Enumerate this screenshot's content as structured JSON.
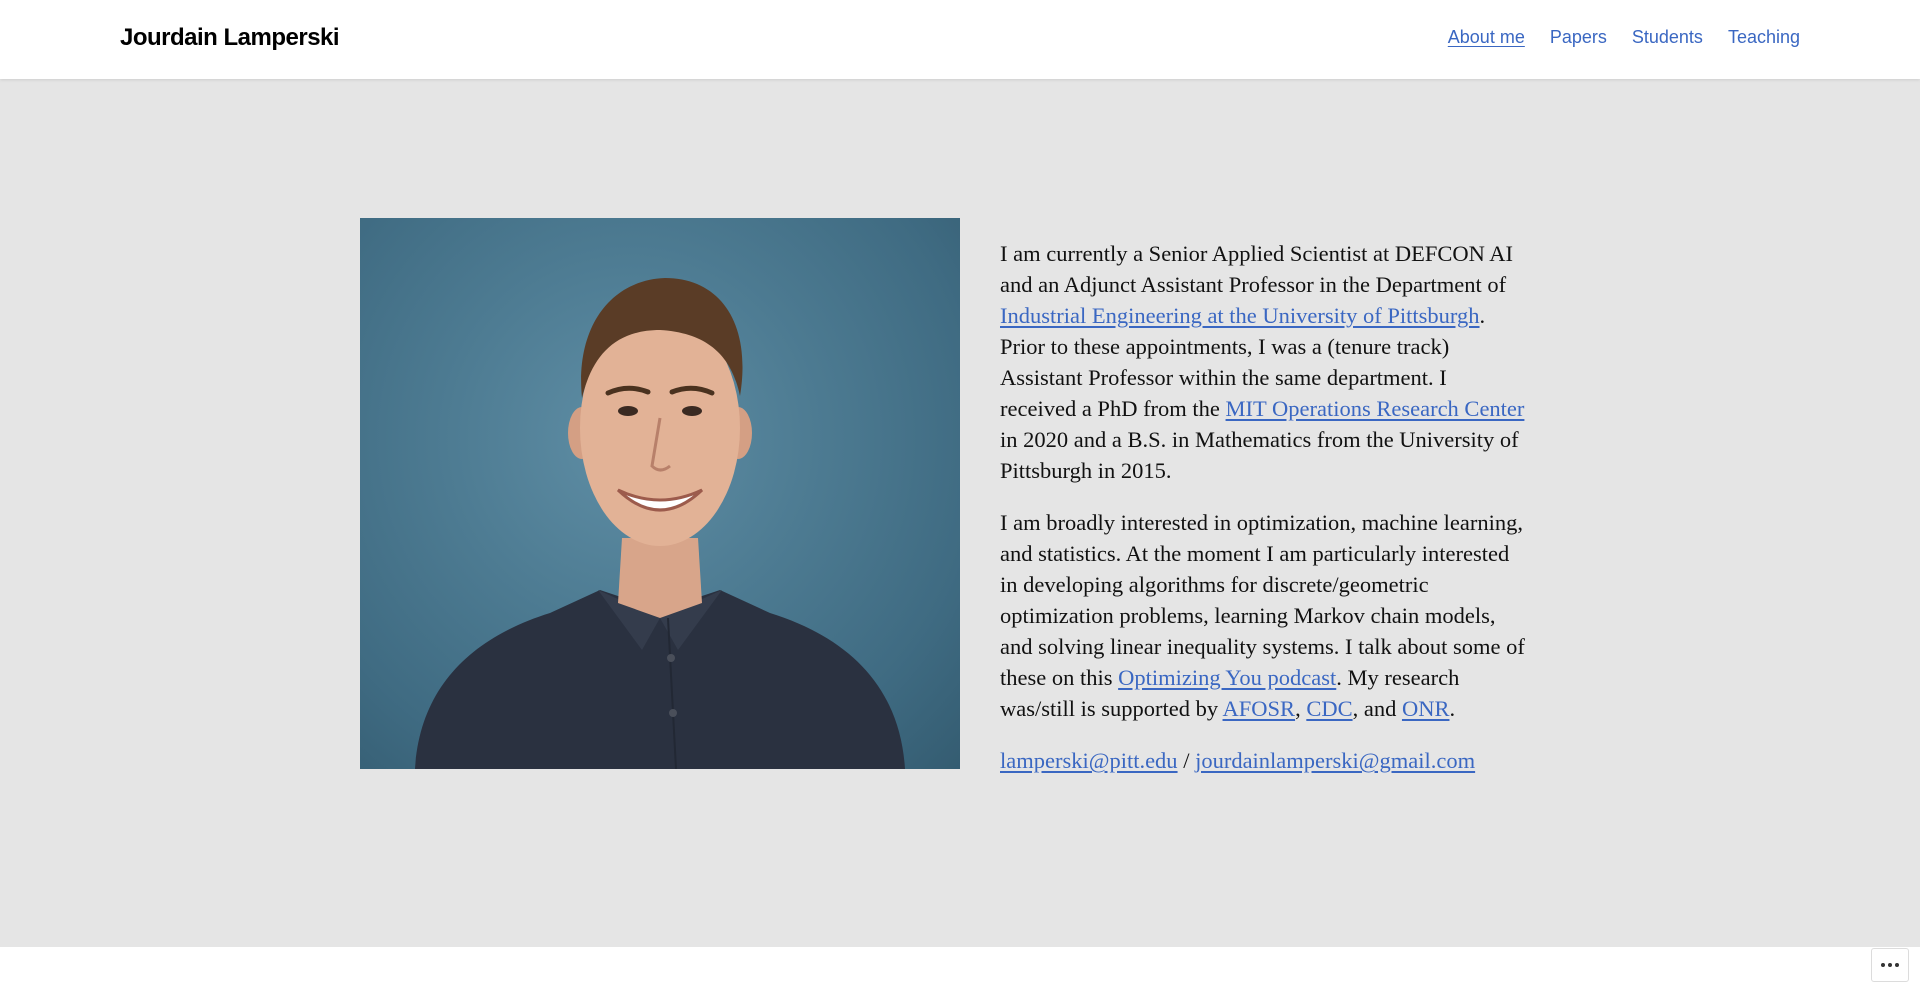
{
  "header": {
    "site_title": "Jourdain Lamperski",
    "nav": [
      {
        "label": "About me",
        "current": true
      },
      {
        "label": "Papers"
      },
      {
        "label": "Students"
      },
      {
        "label": "Teaching"
      }
    ]
  },
  "bio": {
    "p1": {
      "t1": "I am currently a Senior Applied Scientist at DEFCON AI and an Adjunct Assistant Professor in the Department of ",
      "link1": "Industrial Engineering at the University of Pittsburgh",
      "t2": ". Prior to these appointments, I was a (tenure track) Assistant Professor within the same department. I received a PhD from the ",
      "link2": "MIT Operations Research Center",
      "t3": " in 2020 and a B.S. in Mathematics from the University of Pittsburgh in 2015."
    },
    "p2": {
      "t1": "I am broadly interested in optimization, machine learning, and statistics. At the moment I am particularly interested in developing algorithms for discrete/geometric optimization problems, learning Markov chain models, and solving linear inequality systems. I talk about some of these on this ",
      "link_podcast": "Optimizing You podcast",
      "t2": ". My research was/still is supported by ",
      "link_afosr": "AFOSR",
      "sep1": ", ",
      "link_cdc": "CDC",
      "sep2": ", and ",
      "link_onr": "ONR",
      "end": "."
    },
    "contact": {
      "email1": "lamperski@pitt.edu",
      "sep": " / ",
      "email2": "jourdainlamperski@gmail.com"
    }
  },
  "colors": {
    "link": "#3a67c2",
    "main_bg": "#e5e5e5",
    "photo_bg": "#4d7b92"
  },
  "icons": {
    "more_button": "ellipsis-icon"
  }
}
